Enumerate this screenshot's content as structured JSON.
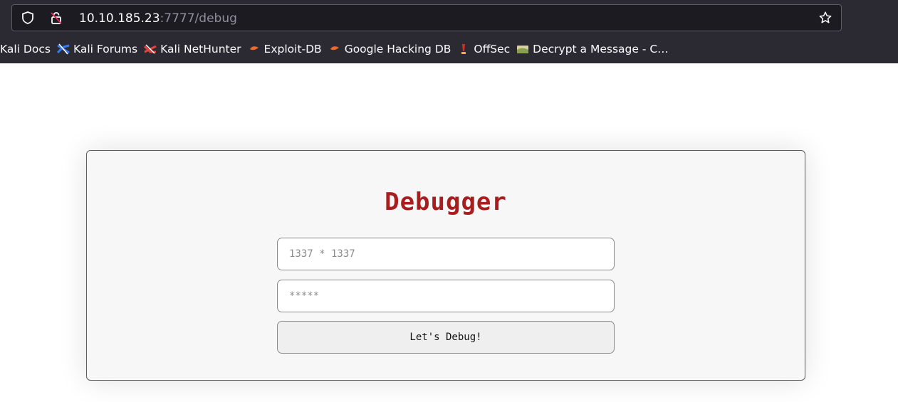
{
  "browser": {
    "url_host": "10.10.185.23",
    "url_path": ":7777/debug",
    "bookmarks": [
      {
        "label": "Kali Docs",
        "icon": "kali-docs-icon",
        "color": "#367bf0"
      },
      {
        "label": "Kali Forums",
        "icon": "kali-forums-icon",
        "color": "#367bf0"
      },
      {
        "label": "Kali NetHunter",
        "icon": "kali-nethunter-icon",
        "color": "#e0443e"
      },
      {
        "label": "Exploit-DB",
        "icon": "exploit-db-icon",
        "color": "#ec6a2c"
      },
      {
        "label": "Google Hacking DB",
        "icon": "ghdb-icon",
        "color": "#ec6a2c"
      },
      {
        "label": "OffSec",
        "icon": "offsec-icon",
        "color": "#d6301f"
      },
      {
        "label": "Decrypt a Message - C…",
        "icon": "decrypt-icon",
        "color": "#b7c46a"
      }
    ]
  },
  "page": {
    "title": "Debugger",
    "expression_placeholder": "1337 * 1337",
    "password_placeholder": "*****",
    "submit_label": "Let's Debug!",
    "title_color": "#a81d1d"
  }
}
